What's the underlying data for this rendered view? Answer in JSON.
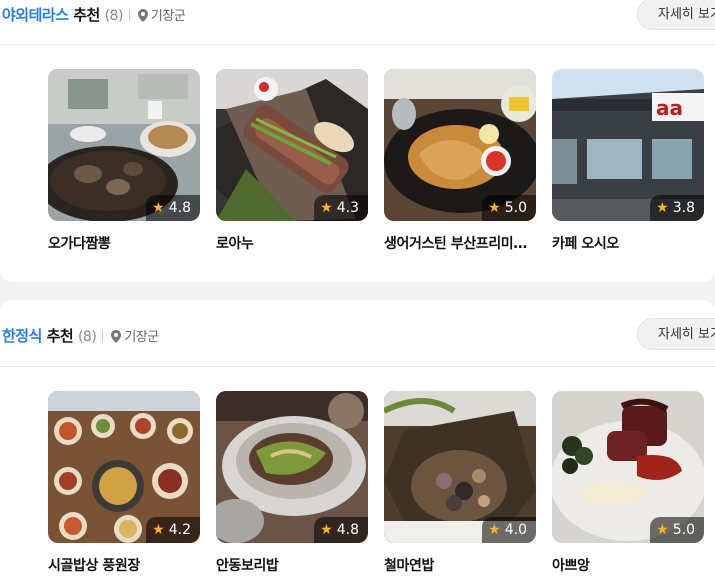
{
  "sections": [
    {
      "keyword": "야외테라스",
      "suffix": " 추천",
      "count": "(8)",
      "location": "기장군",
      "more_label": "자세히 보기",
      "cards": [
        {
          "name": "오가다짬뽕",
          "rating": "4.8"
        },
        {
          "name": "로아누",
          "rating": "4.3"
        },
        {
          "name": "생어거스틴 부산프리미엄아울렛점",
          "rating": "5.0"
        },
        {
          "name": "카페 오시오",
          "rating": "3.8"
        }
      ]
    },
    {
      "keyword": "한정식",
      "suffix": " 추천",
      "count": "(8)",
      "location": "기장군",
      "more_label": "자세히 보기",
      "cards": [
        {
          "name": "시골밥상 풍원장",
          "rating": "4.2"
        },
        {
          "name": "안동보리밥",
          "rating": "4.8"
        },
        {
          "name": "철마연밥",
          "rating": "4.0"
        },
        {
          "name": "아쁘앙",
          "rating": "5.0"
        }
      ]
    }
  ],
  "icons": {
    "location": "map-pin-icon",
    "rating": "star-icon"
  },
  "colors": {
    "keyword": "#2b7de9",
    "star": "#ffb21e"
  }
}
